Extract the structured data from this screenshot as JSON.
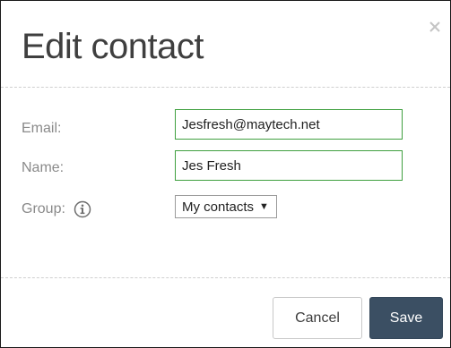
{
  "dialog": {
    "title": "Edit contact",
    "close_icon": "close-icon"
  },
  "form": {
    "email": {
      "label": "Email:",
      "value": "Jesfresh@maytech.net"
    },
    "name": {
      "label": "Name:",
      "value": "Jes Fresh"
    },
    "group": {
      "label": "Group:",
      "selected": "My contacts",
      "info_icon": "info-icon",
      "caret_glyph": "▼"
    }
  },
  "actions": {
    "cancel_label": "Cancel",
    "save_label": "Save"
  },
  "colors": {
    "title_text": "#3f3f3f",
    "label_text": "#8a8a8a",
    "field_border_valid": "#3f9f3f",
    "save_button_bg": "#3b4f63",
    "divider": "#cfcfcf"
  }
}
